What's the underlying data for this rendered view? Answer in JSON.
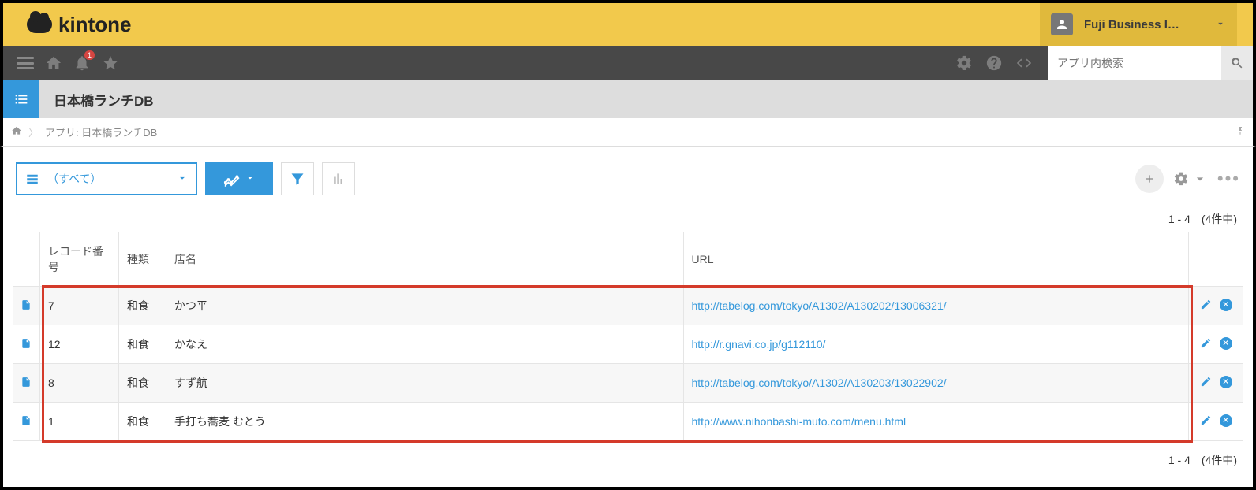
{
  "header": {
    "product_name": "kintone",
    "user_display": "Fuji Business I…",
    "notification_count": "1"
  },
  "search": {
    "placeholder": "アプリ内検索"
  },
  "app": {
    "title": "日本橋ランチDB"
  },
  "breadcrumb": {
    "text": "アプリ: 日本橋ランチDB"
  },
  "view": {
    "selected_label": "（すべて）"
  },
  "pagination": {
    "range_text": "1 - 4　(4件中)"
  },
  "table": {
    "columns": {
      "record_no": "レコード番号",
      "type": "種類",
      "name": "店名",
      "url": "URL"
    },
    "rows": [
      {
        "record_no": "7",
        "type": "和食",
        "name": "かつ平",
        "url": "http://tabelog.com/tokyo/A1302/A130202/13006321/"
      },
      {
        "record_no": "12",
        "type": "和食",
        "name": "かなえ",
        "url": "http://r.gnavi.co.jp/g112110/"
      },
      {
        "record_no": "8",
        "type": "和食",
        "name": "すず航",
        "url": "http://tabelog.com/tokyo/A1302/A130203/13022902/"
      },
      {
        "record_no": "1",
        "type": "和食",
        "name": "手打ち蕎麦 むとう",
        "url": "http://www.nihonbashi-muto.com/menu.html"
      }
    ]
  }
}
